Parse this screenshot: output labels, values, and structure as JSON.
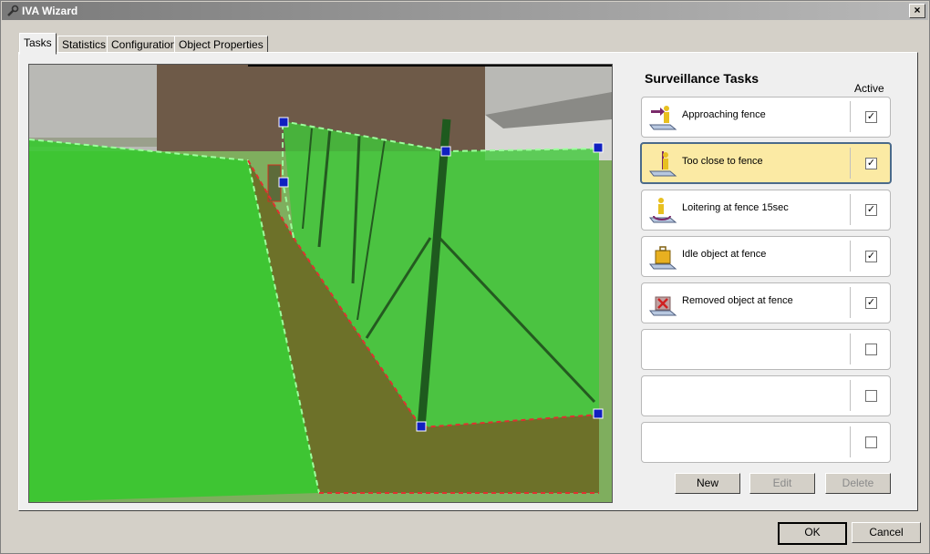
{
  "window": {
    "title": "IVA Wizard",
    "close_glyph": "×"
  },
  "tabs": [
    {
      "label": "Tasks",
      "active": true
    },
    {
      "label": "Statistics",
      "active": false
    },
    {
      "label": "Configuration",
      "active": false
    },
    {
      "label": "Object Properties",
      "active": false
    }
  ],
  "panel": {
    "title": "Surveillance Tasks",
    "active_header": "Active"
  },
  "tasks": [
    {
      "label": "Approaching fence",
      "active": true,
      "icon": "approaching-icon"
    },
    {
      "label": "Too close to fence",
      "active": true,
      "icon": "too-close-icon",
      "selected": true
    },
    {
      "label": "Loitering at fence 15sec",
      "active": true,
      "icon": "loitering-icon"
    },
    {
      "label": "Idle object at fence",
      "active": true,
      "icon": "idle-object-icon"
    },
    {
      "label": "Removed object at fence",
      "active": true,
      "icon": "removed-object-icon"
    },
    {
      "label": "",
      "active": false
    },
    {
      "label": "",
      "active": false
    },
    {
      "label": "",
      "active": false
    }
  ],
  "buttons": {
    "new": "New",
    "edit": "Edit",
    "delete": "Delete",
    "ok": "OK",
    "cancel": "Cancel"
  },
  "check_glyph": "✓",
  "colors": {
    "zone_green": "#3fb83f",
    "zone_red": "#e03030",
    "handle_blue": "#1020c0",
    "selected_row": "#fbeaa4"
  }
}
